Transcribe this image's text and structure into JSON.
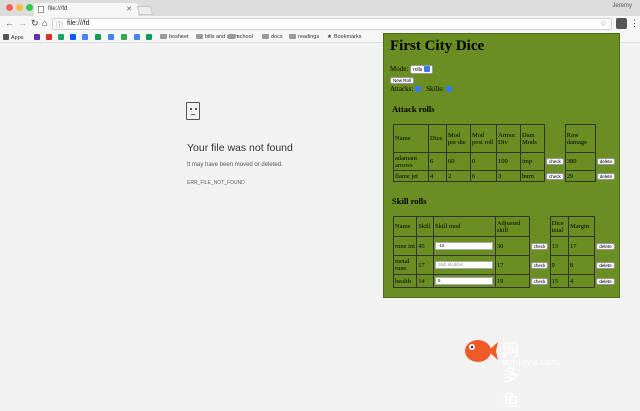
{
  "browser": {
    "tab_title": "file:///fd",
    "user": "Jeremy",
    "url": "file:///fd"
  },
  "bookmarks": [
    {
      "label": "Apps",
      "icon": "apps-grid-icon",
      "color": "#555555"
    },
    {
      "label": "",
      "icon": "yahoo-icon",
      "color": "#5f2eb3"
    },
    {
      "label": "",
      "icon": "gmail-icon",
      "color": "#d93025"
    },
    {
      "label": "",
      "icon": "drive-icon",
      "color": "#1da462"
    },
    {
      "label": "",
      "icon": "dropbox-icon",
      "color": "#0061ff"
    },
    {
      "label": "",
      "icon": "chrome-icon",
      "color": "#4285f4"
    },
    {
      "label": "",
      "icon": "sheets-icon",
      "color": "#0f9d58"
    },
    {
      "label": "",
      "icon": "calendar-icon",
      "color": "#4285f4"
    },
    {
      "label": "",
      "icon": "maps-icon",
      "color": "#34a853"
    },
    {
      "label": "",
      "icon": "contacts-icon",
      "color": "#4285f4"
    },
    {
      "label": "",
      "icon": "hangouts-icon",
      "color": "#0f9d58"
    },
    {
      "label": "bosheet",
      "icon": "folder-icon",
      "color": "#999999"
    },
    {
      "label": "bills and such",
      "icon": "folder-icon",
      "color": "#999999"
    },
    {
      "label": "school",
      "icon": "folder-icon",
      "color": "#999999"
    },
    {
      "label": "docs",
      "icon": "folder-icon",
      "color": "#999999"
    },
    {
      "label": "readings",
      "icon": "folder-icon",
      "color": "#999999"
    },
    {
      "label": "Bookmarks",
      "icon": "star-icon",
      "color": "#555555"
    }
  ],
  "error": {
    "title": "Your file was not found",
    "subtitle": "It may have been moved or deleted.",
    "code": "ERR_FILE_NOT_FOUND"
  },
  "panel": {
    "title": "First City Dice",
    "mode_label": "Mode:",
    "mode_value": "rolls",
    "new_roll": "New Roll",
    "attacks_label": "Attacks:",
    "skills_label": "Skills:",
    "attack_heading": "Attack rolls",
    "attack_headers": [
      "Name",
      "Dice",
      "Mod per die",
      "Mod post roll",
      "Armor Div",
      "Dam Mods",
      "",
      "Raw damage",
      ""
    ],
    "attack_rows": [
      {
        "name": "adamant arrows",
        "dice": "6",
        "mod_per_die": "60",
        "mod_post": "0",
        "armor_div": "100",
        "dam_mods": "imp",
        "check": "check",
        "raw": "380",
        "delete": "delete"
      },
      {
        "name": "flame jet",
        "dice": "4",
        "mod_per_die": "2",
        "mod_post": "6",
        "armor_div": "3",
        "dam_mods": "burn",
        "check": "check",
        "raw": "29",
        "delete": "delete"
      }
    ],
    "skill_heading": "Skill rolls",
    "skill_headers": [
      "Name",
      "Skill",
      "Skill mod",
      "Adjusted skill",
      "",
      "Dice total",
      "Margin",
      ""
    ],
    "skill_rows": [
      {
        "name": "rune int",
        "skill": "45",
        "mod": "-15",
        "mod_placeholder": false,
        "adjusted": "30",
        "check": "check",
        "dice": "13",
        "margin": "17",
        "delete": "delete"
      },
      {
        "name": "metal rune",
        "skill": "17",
        "mod": "Skill Modifier",
        "mod_placeholder": true,
        "adjusted": "17",
        "check": "check",
        "dice": "9",
        "margin": "8",
        "delete": "delete"
      },
      {
        "name": "health",
        "skill": "14",
        "mod": "5",
        "mod_placeholder": false,
        "adjusted": "19",
        "check": "check",
        "dice": "15",
        "margin": "4",
        "delete": "delete"
      }
    ]
  },
  "watermark": {
    "text": "网多鱼",
    "url": "wduoyu.com"
  }
}
